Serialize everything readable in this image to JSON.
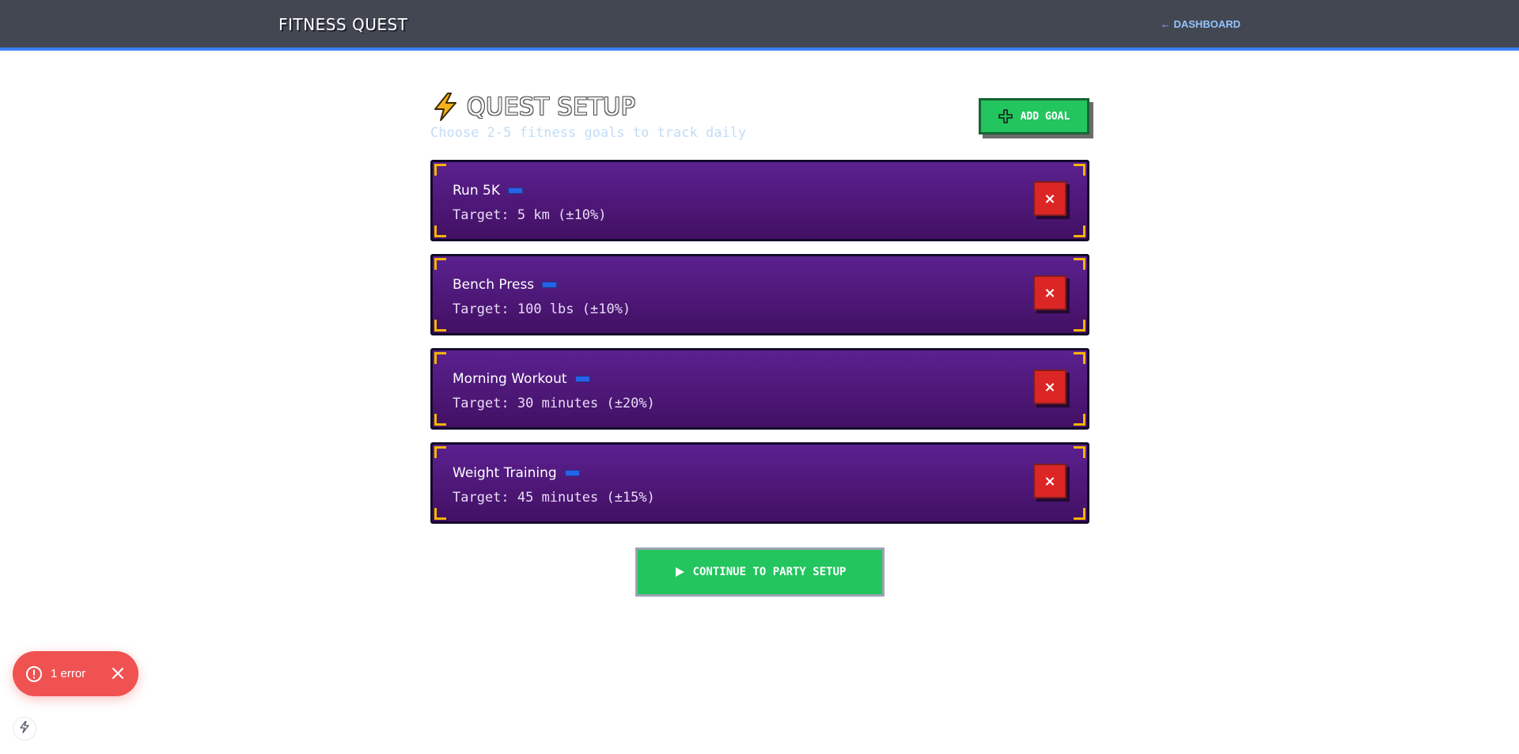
{
  "header": {
    "brand": "FITNESS QUEST",
    "back_link": "← DASHBOARD"
  },
  "setup": {
    "title": "QUEST SETUP",
    "subtitle": "Choose 2-5 fitness goals to track daily",
    "add_goal_label": "ADD GOAL"
  },
  "goals": [
    {
      "name": "Run 5K",
      "target": "Target: 5 km (±10%)"
    },
    {
      "name": "Bench Press",
      "target": "Target: 100 lbs (±10%)"
    },
    {
      "name": "Morning Workout",
      "target": "Target: 30 minutes (±20%)"
    },
    {
      "name": "Weight Training",
      "target": "Target: 45 minutes (±15%)"
    }
  ],
  "remove_label": "×",
  "continue_label": "CONTINUE TO PARTY SETUP",
  "toast": {
    "label": "1 error"
  },
  "icons": {
    "title": "lightning-bolt-icon",
    "add": "plus-icon",
    "continue": "play-icon",
    "toast": "alert-circle-icon",
    "close": "close-icon",
    "bottom": "bolt-outline-icon"
  },
  "colors": {
    "header_bg": "#434752",
    "accent_blue": "#3b82f6",
    "card_purple": "#5b2190",
    "card_corner": "#f4b400",
    "green_button": "#22c55e",
    "red_button": "#dc2626",
    "toast_red": "#f05252"
  }
}
